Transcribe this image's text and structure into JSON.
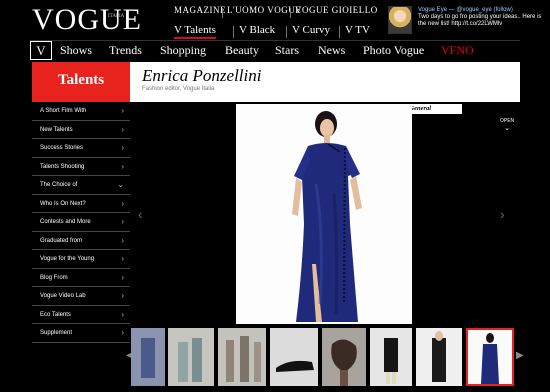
{
  "header": {
    "logo": "VOGUE",
    "logo_sub": "ITALIA",
    "top_links": [
      "MAGAZINE",
      "L'UOMO VOGUE",
      "VOGUE GIOIELLO"
    ],
    "sub_links": [
      "V Talents",
      "V Black",
      "V Curvy",
      "V TV"
    ],
    "tweet": {
      "handle": "Vogue Eye — @vogue_eye (follow)",
      "text": "Two days to go fro posting your ideas.. Here is the new list! http://t.co/22LWMlv"
    }
  },
  "mainnav": {
    "v": "V",
    "items": [
      "Shows",
      "Trends",
      "Shopping",
      "Beauty",
      "Stars",
      "News",
      "Photo Vogue",
      "VFNO"
    ]
  },
  "section": {
    "title": "Talents",
    "name": "Enrica Ponzellini",
    "role": "Fashion editor, Vogue Italia"
  },
  "sidebar": {
    "items": [
      "A Short Film With",
      "New Talents",
      "Success Stories",
      "Talents Shooting",
      "The Choice of",
      "Who Is On Next?",
      "Contests and More",
      "Graduated from",
      "Vogue for the Young",
      "Blog From",
      "Vogue Video Lab",
      "Eco Talents",
      "Supplement"
    ],
    "expanded_index": 4
  },
  "gallery": {
    "caption": "Mandarin & General",
    "open_label": "OPEN",
    "selected_thumb": 7
  },
  "colors": {
    "accent": "#e8231e",
    "dress": "#1f2a7a"
  }
}
